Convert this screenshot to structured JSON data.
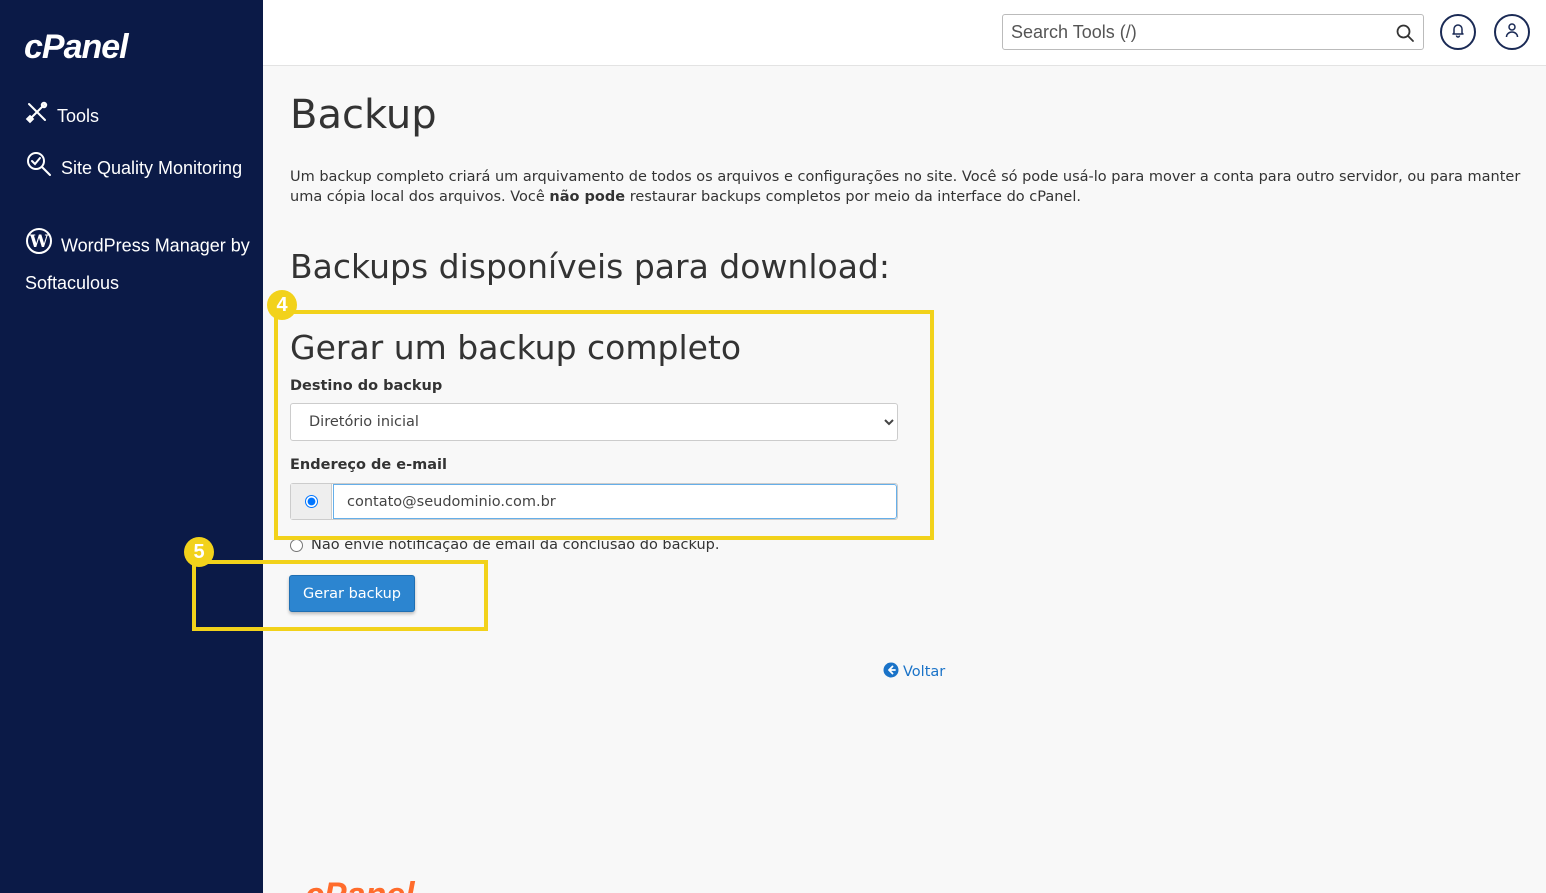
{
  "sidebar": {
    "logo": "cPanel",
    "items": [
      {
        "label": "Tools",
        "icon": "tools-icon"
      },
      {
        "label": "Site Quality Monitoring",
        "icon": "search-check-icon"
      },
      {
        "label": "WordPress Manager by Softaculous",
        "icon": "wordpress-icon"
      }
    ]
  },
  "header": {
    "search_placeholder": "Search Tools (/)"
  },
  "main": {
    "title": "Backup",
    "description_part1": "Um backup completo criará um arquivamento de todos os arquivos e configurações no site. Você só pode usá-lo para mover a conta para outro servidor, ou para manter uma cópia local dos arquivos. Você ",
    "description_bold": "não pode",
    "description_part2": " restaurar backups completos por meio da interface do cPanel.",
    "available_heading": "Backups disponíveis para download:",
    "generate_heading": "Gerar um backup completo",
    "destination_label": "Destino do backup",
    "destination_selected": "Diretório inicial",
    "email_label": "Endereço de e-mail",
    "email_value": "contato@seudominio.com.br",
    "no_notify_label": "Não envie notificação de email da conclusão do backup.",
    "generate_button": "Gerar backup",
    "back_link": "Voltar"
  },
  "annotations": {
    "step4": "4",
    "step5": "5",
    "highlight_color": "#f2d21b"
  },
  "footer": {
    "logo": "cPanel"
  },
  "colors": {
    "sidebar_bg": "#0b1a47",
    "primary_button": "#2c85d0",
    "link": "#1a73c8",
    "footer_logo": "#ff6c2c"
  }
}
